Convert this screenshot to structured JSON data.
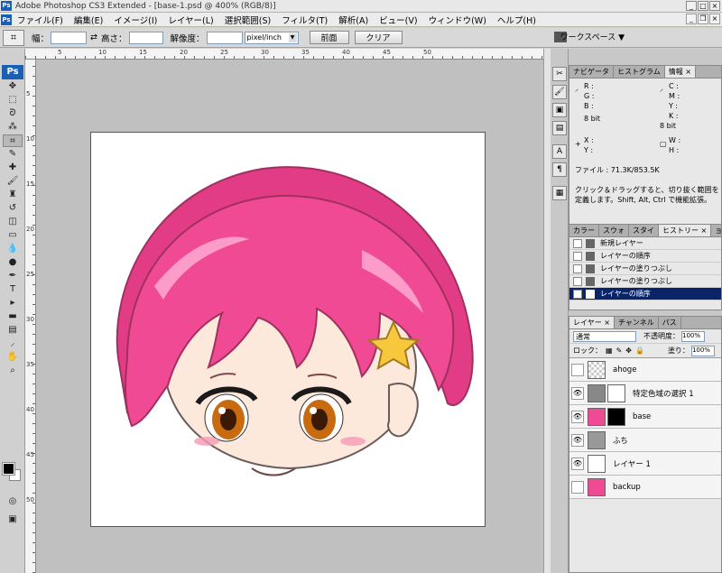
{
  "window": {
    "title": "Adobe Photoshop CS3 Extended - [base-1.psd @ 400% (RGB/8)]",
    "app_icon": "Ps"
  },
  "menu": [
    "ファイル(F)",
    "編集(E)",
    "イメージ(I)",
    "レイヤー(L)",
    "選択範囲(S)",
    "フィルタ(T)",
    "解析(A)",
    "ビュー(V)",
    "ウィンドウ(W)",
    "ヘルプ(H)"
  ],
  "options": {
    "width_label": "幅：",
    "height_label": "高さ：",
    "resolution_label": "解像度：",
    "unit": "pixel/inch",
    "front_button": "前面",
    "clear_button": "クリア",
    "workspace": "ワークスペース ▼"
  },
  "ruler_numbers": [
    "5",
    "10",
    "15",
    "20",
    "25",
    "30",
    "35",
    "40",
    "45",
    "50"
  ],
  "ruler_left_numbers": [
    "5",
    "10",
    "15",
    "20",
    "25",
    "30",
    "35",
    "40",
    "45",
    "50"
  ],
  "info_panel": {
    "tabs": [
      "ナビゲータ",
      "ヒストグラム",
      "情報 ×"
    ],
    "left": [
      "R :",
      "G :",
      "B :",
      "8 bit",
      "X :",
      "Y :"
    ],
    "right": [
      "C :",
      "M :",
      "Y :",
      "K :",
      "8 bit",
      "W :",
      "H :"
    ],
    "file": "ファイル : 71.3K/853.5K",
    "help": "クリック＆ドラッグすると、切り抜く範囲を定義します。Shift, Alt, Ctrl で機能拡張。"
  },
  "history_panel": {
    "tabs": [
      "カラー",
      "スウォ",
      "スタイ",
      "ヒストリー ×",
      "ョション"
    ],
    "items": [
      "新規レイヤー",
      "レイヤーの順序",
      "レイヤーの塗りつぶし",
      "レイヤーの塗りつぶし",
      "レイヤーの順序"
    ]
  },
  "layers_panel": {
    "tabs": [
      "レイヤー ×",
      "チャンネル",
      "パス"
    ],
    "blend_mode": "通常",
    "opacity_label": "不透明度：",
    "opacity": "100%",
    "lock_label": "ロック：",
    "fill_label": "塗り：",
    "fill": "100%",
    "layers": [
      "ahoge",
      "特定色域の選択 1",
      "base",
      "ふち",
      "レイヤー 1",
      "backup"
    ]
  },
  "colors": {
    "hair": "#f04a94",
    "accent": "#0a246a"
  }
}
